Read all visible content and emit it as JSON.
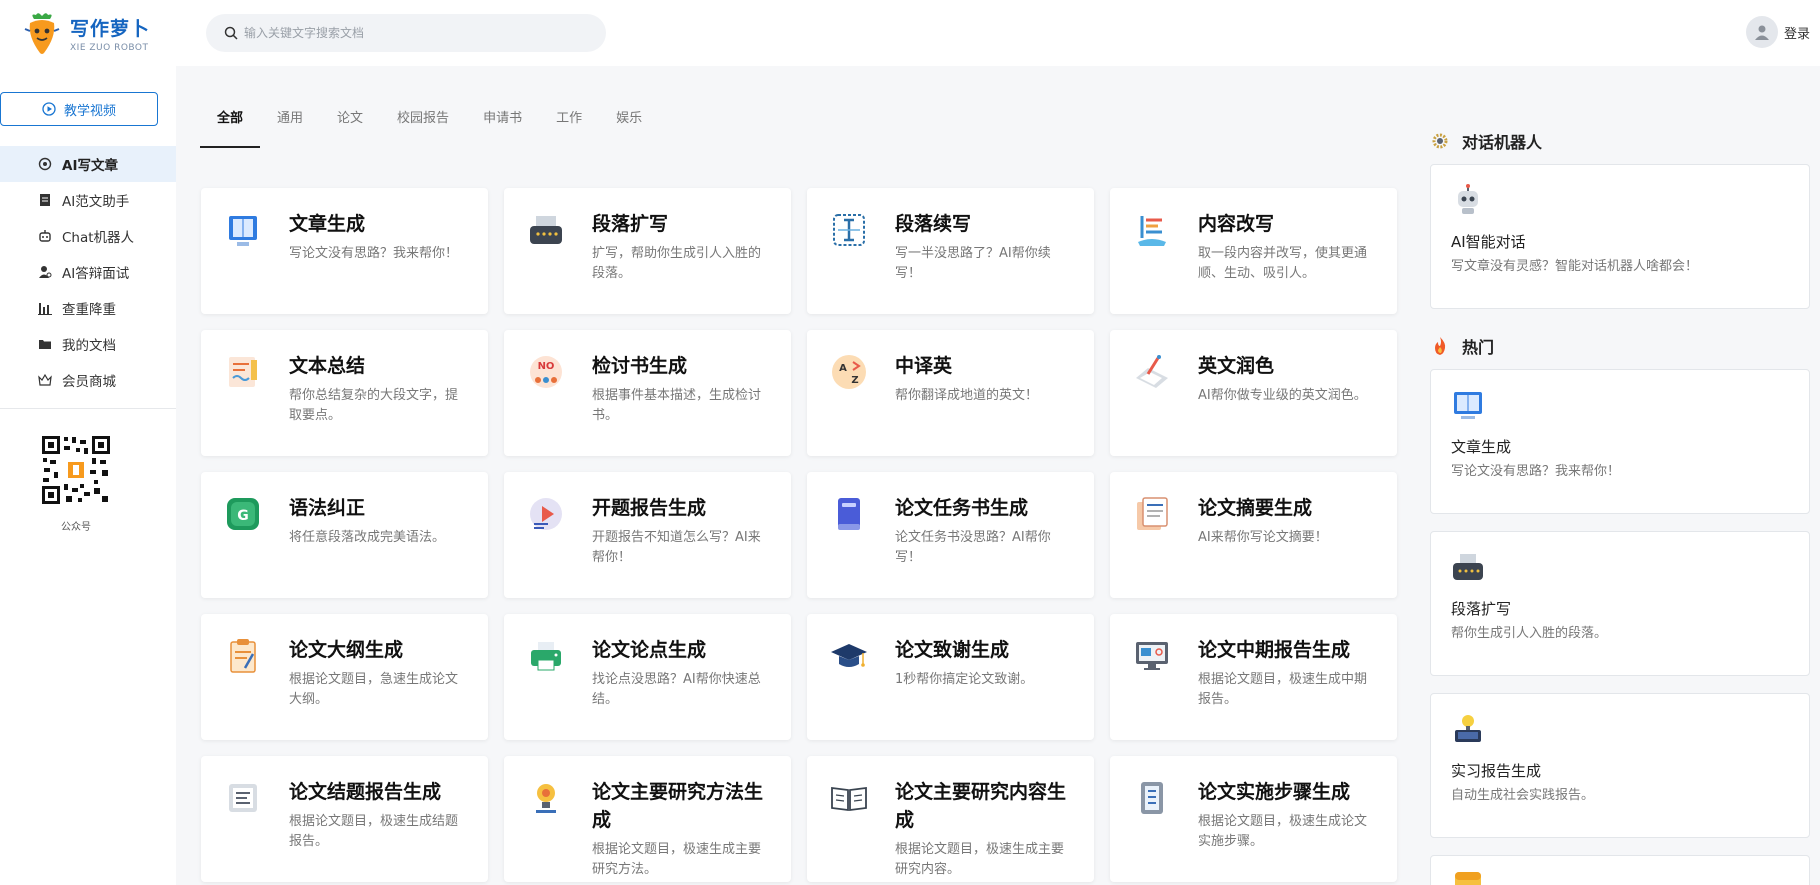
{
  "header": {
    "logo_main": "写作萝卜",
    "logo_sub": "XIE ZUO ROBOT",
    "search_placeholder": "输入关键文字搜索文档",
    "login_label": "登录"
  },
  "sidebar": {
    "video_button": "教学视频",
    "items": [
      {
        "label": "AI写文章",
        "icon": "robot-icon",
        "active": true
      },
      {
        "label": "AI范文助手",
        "icon": "document-icon"
      },
      {
        "label": "Chat机器人",
        "icon": "robot-head-icon"
      },
      {
        "label": "AI答辩面试",
        "icon": "person-icon"
      },
      {
        "label": "查重降重",
        "icon": "bar-chart-icon"
      },
      {
        "label": "我的文档",
        "icon": "folder-icon"
      },
      {
        "label": "会员商城",
        "icon": "crown-icon"
      }
    ],
    "qr_label": "公众号"
  },
  "tabs": [
    {
      "label": "全部",
      "active": true
    },
    {
      "label": "通用"
    },
    {
      "label": "论文"
    },
    {
      "label": "校园报告"
    },
    {
      "label": "申请书"
    },
    {
      "label": "工作"
    },
    {
      "label": "娱乐"
    }
  ],
  "cards": [
    {
      "title": "文章生成",
      "desc": "写论文没有思路？我来帮你！",
      "icon": "book-icon"
    },
    {
      "title": "段落扩写",
      "desc": "扩写，帮助你生成引人入胜的段落。",
      "icon": "typewriter-icon"
    },
    {
      "title": "段落续写",
      "desc": "写一半没思路了？AI帮你续写！",
      "icon": "text-cursor-icon"
    },
    {
      "title": "内容改写",
      "desc": "取一段内容并改写，使其更通顺、生动、吸引人。",
      "icon": "pen-edit-icon"
    },
    {
      "title": "文本总结",
      "desc": "帮你总结复杂的大段文字，提取要点。",
      "icon": "notes-icon"
    },
    {
      "title": "检讨书生成",
      "desc": "根据事件基本描述，生成检讨书。",
      "icon": "no-sign-icon"
    },
    {
      "title": "中译英",
      "desc": "帮你翻译成地道的英文！",
      "icon": "translate-icon"
    },
    {
      "title": "英文润色",
      "desc": "AI帮你做专业级的英文润色。",
      "icon": "polish-icon"
    },
    {
      "title": "语法纠正",
      "desc": "将任意段落改成完美语法。",
      "icon": "grammar-icon"
    },
    {
      "title": "开题报告生成",
      "desc": "开题报告不知道怎么写？AI来帮你！",
      "icon": "presentation-icon"
    },
    {
      "title": "论文任务书生成",
      "desc": "论文任务书没思路？AI帮你写！",
      "icon": "notebook-icon"
    },
    {
      "title": "论文摘要生成",
      "desc": "AI来帮你写论文摘要！",
      "icon": "abstract-icon"
    },
    {
      "title": "论文大纲生成",
      "desc": "根据论文题目，急速生成论文大纲。",
      "icon": "clipboard-icon"
    },
    {
      "title": "论文论点生成",
      "desc": "找论点没思路？AI帮你快速总结。",
      "icon": "printer-icon"
    },
    {
      "title": "论文致谢生成",
      "desc": "1秒帮你搞定论文致谢。",
      "icon": "graduation-cap-icon"
    },
    {
      "title": "论文中期报告生成",
      "desc": "根据论文题目，极速生成中期报告。",
      "icon": "monitor-icon"
    },
    {
      "title": "论文结题报告生成",
      "desc": "根据论文题目，极速生成结题报告。",
      "icon": "report-icon"
    },
    {
      "title": "论文主要研究方法生成",
      "desc": "根据论文题目，极速生成主要研究方法。",
      "icon": "lightbulb-icon"
    },
    {
      "title": "论文主要研究内容生成",
      "desc": "根据论文题目，极速生成主要研究内容。",
      "icon": "open-book-icon"
    },
    {
      "title": "论文实施步骤生成",
      "desc": "根据论文题目，极速生成论文实施步骤。",
      "icon": "steps-icon"
    }
  ],
  "right": {
    "chat_title": "对话机器人",
    "chat_card": {
      "title": "AI智能对话",
      "desc": "写文章没有灵感？智能对话机器人啥都会！"
    },
    "hot_title": "热门",
    "hot_cards": [
      {
        "title": "文章生成",
        "desc": "写论文没有思路？我来帮你！",
        "icon": "book-icon"
      },
      {
        "title": "段落扩写",
        "desc": "帮你生成引人入胜的段落。",
        "icon": "typewriter-icon"
      },
      {
        "title": "实习报告生成",
        "desc": "自动生成社会实践报告。",
        "icon": "lightbulb-laptop-icon"
      }
    ]
  },
  "colors": {
    "accent": "#1976d2",
    "active_bg": "#e8f1fb",
    "text": "#222222",
    "muted": "#777777"
  }
}
